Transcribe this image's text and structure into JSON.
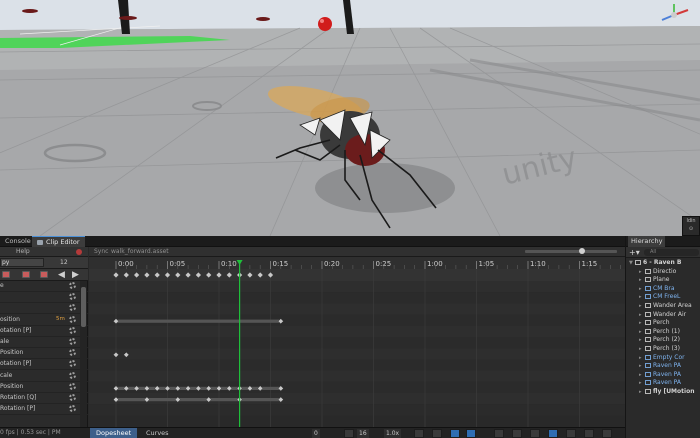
{
  "colors": {
    "accent": "#4a90d9",
    "playhead": "#1fbf3a",
    "record": "#b53a3a",
    "selected_tab": "#3d5f8a",
    "scene_floor": "#a6a7a9",
    "keyframe": "#c8c8c8"
  },
  "anim_window": {
    "tabs": [
      "Console",
      "Clip Editor"
    ],
    "help_label": "Help",
    "dropdown_value": "py",
    "frame_value": "12",
    "sync_label": "Sync",
    "clip_name": "walk_forward.asset",
    "properties": [
      {
        "name": "e",
        "value": ""
      },
      {
        "name": "",
        "value": ""
      },
      {
        "name": "",
        "value": ""
      },
      {
        "name": "osition",
        "value": "5m"
      },
      {
        "name": "otation [P]",
        "value": ""
      },
      {
        "name": "ale",
        "value": ""
      },
      {
        "name": "Position",
        "value": ""
      },
      {
        "name": "otation [P]",
        "value": ""
      },
      {
        "name": "cale",
        "value": ""
      },
      {
        "name": "Position",
        "value": ""
      },
      {
        "name": "Rotation [Q]",
        "value": ""
      },
      {
        "name": "Rotation [P]",
        "value": ""
      }
    ],
    "bottom_left_text": "0 fps | 0.53 sec | PM",
    "bottom_tabs": [
      "Dopesheet",
      "Curves"
    ],
    "bottom_numbers": [
      "0",
      "16",
      "1.0x"
    ]
  },
  "timeline": {
    "tick_labels": [
      "0:00",
      "0:05",
      "0:10",
      "0:15",
      "0:20",
      "0:25",
      "1:00",
      "1:05",
      "1:10",
      "1:15"
    ],
    "playhead_time": "0:10",
    "summary_keys": [
      "0:00",
      "0:01",
      "0:02",
      "0:03",
      "0:04",
      "0:05",
      "0:06",
      "0:07",
      "0:08",
      "0:09",
      "0:10",
      "0:11",
      "0:12",
      "0:13",
      "0:14",
      "0:15"
    ],
    "track_keys": [
      {
        "row": 4,
        "keys": [
          "0:00",
          "0:16"
        ],
        "bar": true
      },
      {
        "row": 7,
        "keys": [
          "0:00",
          "0:01"
        ],
        "bar": false
      },
      {
        "row": 10,
        "keys": [
          "0:00",
          "0:01",
          "0:02",
          "0:03",
          "0:04",
          "0:05",
          "0:06",
          "0:07",
          "0:08",
          "0:09",
          "0:10",
          "0:11",
          "0:12",
          "0:13",
          "0:14",
          "0:16"
        ],
        "bar": true
      },
      {
        "row": 11,
        "keys": [
          "0:00",
          "0:03",
          "0:06",
          "0:09",
          "0:12",
          "0:16"
        ],
        "bar": true
      }
    ]
  },
  "hierarchy": {
    "tab_label": "Hierarchy",
    "search_placeholder": "All",
    "items": [
      {
        "label": "6 - Raven B",
        "style": "bold",
        "indent": 0,
        "expanded": true
      },
      {
        "label": "Directio",
        "style": "normal",
        "indent": 1
      },
      {
        "label": "Plane",
        "style": "normal",
        "indent": 1
      },
      {
        "label": "CM Bra",
        "style": "blue",
        "indent": 1
      },
      {
        "label": "CM FreeL",
        "style": "blue",
        "indent": 1
      },
      {
        "label": "Wander Area",
        "style": "normal",
        "indent": 1
      },
      {
        "label": "Wander Air",
        "style": "normal",
        "indent": 1
      },
      {
        "label": "Perch",
        "style": "normal",
        "indent": 1
      },
      {
        "label": "Perch (1)",
        "style": "normal",
        "indent": 1
      },
      {
        "label": "Perch (2)",
        "style": "normal",
        "indent": 1
      },
      {
        "label": "Perch (3)",
        "style": "normal",
        "indent": 1
      },
      {
        "label": "Empty Cor",
        "style": "blue",
        "indent": 1
      },
      {
        "label": "Raven PA",
        "style": "blue",
        "indent": 1
      },
      {
        "label": "Raven PA",
        "style": "blue",
        "indent": 1
      },
      {
        "label": "Raven PA",
        "style": "blue",
        "indent": 1
      },
      {
        "label": "fly [UMotion",
        "style": "bold",
        "indent": 1
      }
    ]
  }
}
